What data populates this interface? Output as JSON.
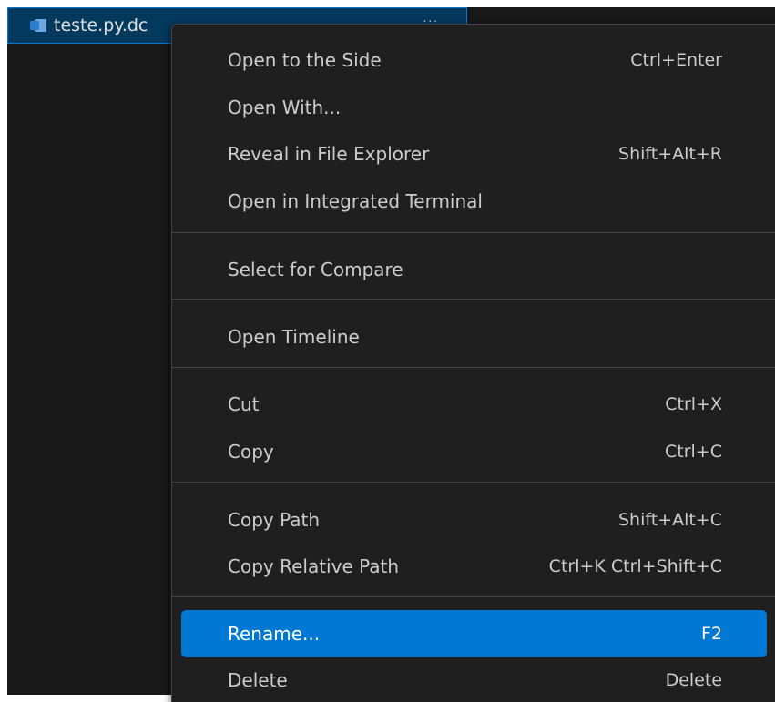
{
  "explorer": {
    "file_name": "teste.py.dc",
    "file_icon": "word-document-icon",
    "tab_overflow": "..."
  },
  "context_menu": {
    "items": [
      {
        "label": "Open to the Side",
        "shortcut": "Ctrl+Enter"
      },
      {
        "label": "Open With...",
        "shortcut": ""
      },
      {
        "label": "Reveal in File Explorer",
        "shortcut": "Shift+Alt+R"
      },
      {
        "label": "Open in Integrated Terminal",
        "shortcut": ""
      },
      {
        "label": "Select for Compare",
        "shortcut": ""
      },
      {
        "label": "Open Timeline",
        "shortcut": ""
      },
      {
        "label": "Cut",
        "shortcut": "Ctrl+X"
      },
      {
        "label": "Copy",
        "shortcut": "Ctrl+C"
      },
      {
        "label": "Copy Path",
        "shortcut": "Shift+Alt+C"
      },
      {
        "label": "Copy Relative Path",
        "shortcut": "Ctrl+K Ctrl+Shift+C"
      },
      {
        "label": "Rename...",
        "shortcut": "F2",
        "selected": true
      },
      {
        "label": "Delete",
        "shortcut": "Delete"
      }
    ]
  },
  "colors": {
    "menu_background": "#1f1f1f",
    "selection": "#0078d4",
    "explorer_background": "#181818",
    "text": "#cccccc"
  }
}
